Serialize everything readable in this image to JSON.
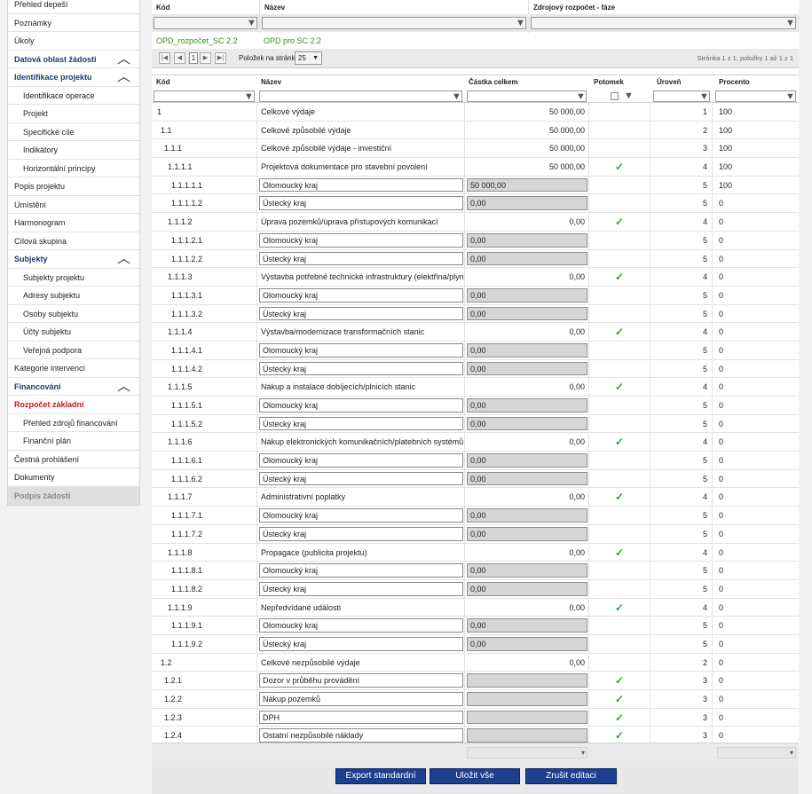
{
  "sidebar": {
    "items": [
      {
        "label": "Přehled depeší",
        "kind": "item"
      },
      {
        "label": "Poznámky",
        "kind": "item"
      },
      {
        "label": "Úkoly",
        "kind": "item"
      },
      {
        "label": "Datová oblast žádosti",
        "kind": "section",
        "chevron": "up"
      },
      {
        "label": "Identifikace projektu",
        "kind": "section",
        "chevron": "up"
      },
      {
        "label": "Identifikace operace",
        "kind": "sub"
      },
      {
        "label": "Projekt",
        "kind": "sub"
      },
      {
        "label": "Specifické cíle",
        "kind": "sub"
      },
      {
        "label": "Indikátory",
        "kind": "sub"
      },
      {
        "label": "Horizontální principy",
        "kind": "sub"
      },
      {
        "label": "Popis projektu",
        "kind": "item"
      },
      {
        "label": "Umístění",
        "kind": "item"
      },
      {
        "label": "Harmonogram",
        "kind": "item"
      },
      {
        "label": "Cílová skupina",
        "kind": "item"
      },
      {
        "label": "Subjekty",
        "kind": "section",
        "chevron": "up"
      },
      {
        "label": "Subjekty projektu",
        "kind": "sub"
      },
      {
        "label": "Adresy subjektu",
        "kind": "sub"
      },
      {
        "label": "Osoby subjektu",
        "kind": "sub"
      },
      {
        "label": "Účty subjektu",
        "kind": "sub"
      },
      {
        "label": "Veřejná podpora",
        "kind": "sub"
      },
      {
        "label": "Kategorie intervencí",
        "kind": "item"
      },
      {
        "label": "Financování",
        "kind": "section",
        "chevron": "up"
      },
      {
        "label": "Rozpočet základní",
        "kind": "active"
      },
      {
        "label": "Přehled zdrojů financování",
        "kind": "sub"
      },
      {
        "label": "Finanční plán",
        "kind": "sub"
      },
      {
        "label": "Čestná prohlášení",
        "kind": "item"
      },
      {
        "label": "Dokumenty",
        "kind": "item"
      },
      {
        "label": "Podpis žádosti",
        "kind": "disabled"
      }
    ]
  },
  "top_grid": {
    "headers": {
      "code": "Kód",
      "name": "Název",
      "source": "Zdrojový rozpočet - fáze"
    },
    "row": {
      "code": "OPD_rozpočet_SC 2.2",
      "name": "OPD pro SC 2.2",
      "source": ""
    }
  },
  "pager": {
    "first": "|◀",
    "prev": "◀",
    "page": "1",
    "next": "▶",
    "last": "▶|",
    "per_page_label": "Položek na stránku",
    "per_page_value": "25",
    "summary": "Stránka 1 z 1, položky 1 až 1 z 1"
  },
  "grid": {
    "headers": {
      "code": "Kód",
      "name": "Název",
      "amount": "Částka celkem",
      "child": "Potomek",
      "level": "Úroveň",
      "percent": "Procento"
    },
    "rows": [
      {
        "code": "1",
        "indent": 0,
        "name": "Celkové výdaje",
        "amount": "50 000,00",
        "mode": "text",
        "check": false,
        "level": "1",
        "percent": "100"
      },
      {
        "code": "1.1",
        "indent": 1,
        "name": "Celkové způsobilé výdaje",
        "amount": "50 000,00",
        "mode": "text",
        "check": false,
        "level": "2",
        "percent": "100"
      },
      {
        "code": "1.1.1",
        "indent": 2,
        "name": "Celkové způsobilé výdaje - investiční",
        "amount": "50 000,00",
        "mode": "text",
        "check": false,
        "level": "3",
        "percent": "100"
      },
      {
        "code": "1.1.1.1",
        "indent": 3,
        "name": "Projektová dokumentace pro stavební povolení",
        "amount": "50 000,00",
        "mode": "text",
        "check": true,
        "level": "4",
        "percent": "100"
      },
      {
        "code": "1.1.1.1.1",
        "indent": 4,
        "name": "Olomoucký kraj",
        "amount": "50 000,00",
        "mode": "input",
        "check": false,
        "level": "5",
        "percent": "100"
      },
      {
        "code": "1.1.1.1.2",
        "indent": 4,
        "name": "Ústecký kraj",
        "amount": "0,00",
        "mode": "input",
        "check": false,
        "level": "5",
        "percent": "0"
      },
      {
        "code": "1.1.1.2",
        "indent": 3,
        "name": "Úprava pozemků/úprava přístupových komunikací",
        "amount": "0,00",
        "mode": "text",
        "check": true,
        "level": "4",
        "percent": "0"
      },
      {
        "code": "1.1.1.2.1",
        "indent": 4,
        "name": "Olomoucký kraj",
        "amount": "0,00",
        "mode": "input",
        "check": false,
        "level": "5",
        "percent": "0"
      },
      {
        "code": "1.1.1.2.2",
        "indent": 4,
        "name": "Ústecký kraj",
        "amount": "0,00",
        "mode": "input",
        "check": false,
        "level": "5",
        "percent": "0"
      },
      {
        "code": "1.1.1.3",
        "indent": 3,
        "name": "Výstavba potřebné technické infrastruktury (elektřina/plyn)",
        "amount": "0,00",
        "mode": "text",
        "check": true,
        "level": "4",
        "percent": "0"
      },
      {
        "code": "1.1.1.3.1",
        "indent": 4,
        "name": "Olomoucký kraj",
        "amount": "0,00",
        "mode": "input",
        "check": false,
        "level": "5",
        "percent": "0"
      },
      {
        "code": "1.1.1.3.2",
        "indent": 4,
        "name": "Ústecký kraj",
        "amount": "0,00",
        "mode": "input",
        "check": false,
        "level": "5",
        "percent": "0"
      },
      {
        "code": "1.1.1.4",
        "indent": 3,
        "name": "Výstavba/modernizace transformačních stanic",
        "amount": "0,00",
        "mode": "text",
        "check": true,
        "level": "4",
        "percent": "0"
      },
      {
        "code": "1.1.1.4.1",
        "indent": 4,
        "name": "Olomoucký kraj",
        "amount": "0,00",
        "mode": "input",
        "check": false,
        "level": "5",
        "percent": "0"
      },
      {
        "code": "1.1.1.4.2",
        "indent": 4,
        "name": "Ústecký kraj",
        "amount": "0,00",
        "mode": "input",
        "check": false,
        "level": "5",
        "percent": "0"
      },
      {
        "code": "1.1.1.5",
        "indent": 3,
        "name": "Nákup a instalace dobíjecích/plnicích stanic",
        "amount": "0,00",
        "mode": "text",
        "check": true,
        "level": "4",
        "percent": "0"
      },
      {
        "code": "1.1.1.5.1",
        "indent": 4,
        "name": "Olomoucký kraj",
        "amount": "0,00",
        "mode": "input",
        "check": false,
        "level": "5",
        "percent": "0"
      },
      {
        "code": "1.1.1.5.2",
        "indent": 4,
        "name": "Ústecký kraj",
        "amount": "0,00",
        "mode": "input",
        "check": false,
        "level": "5",
        "percent": "0"
      },
      {
        "code": "1.1.1.6",
        "indent": 3,
        "name": "Nákup elektronických komunikačních/platebních systémů",
        "amount": "0,00",
        "mode": "text",
        "check": true,
        "level": "4",
        "percent": "0"
      },
      {
        "code": "1.1.1.6.1",
        "indent": 4,
        "name": "Olomoucký kraj",
        "amount": "0,00",
        "mode": "input",
        "check": false,
        "level": "5",
        "percent": "0"
      },
      {
        "code": "1.1.1.6.2",
        "indent": 4,
        "name": "Ústecký kraj",
        "amount": "0,00",
        "mode": "input",
        "check": false,
        "level": "5",
        "percent": "0"
      },
      {
        "code": "1.1.1.7",
        "indent": 3,
        "name": "Administrativní poplatky",
        "amount": "0,00",
        "mode": "text",
        "check": true,
        "level": "4",
        "percent": "0"
      },
      {
        "code": "1.1.1.7.1",
        "indent": 4,
        "name": "Olomoucký kraj",
        "amount": "0,00",
        "mode": "input",
        "check": false,
        "level": "5",
        "percent": "0"
      },
      {
        "code": "1.1.1.7.2",
        "indent": 4,
        "name": "Ústecký kraj",
        "amount": "0,00",
        "mode": "input",
        "check": false,
        "level": "5",
        "percent": "0"
      },
      {
        "code": "1.1.1.8",
        "indent": 3,
        "name": "Propagace (publicita projektu)",
        "amount": "0,00",
        "mode": "text",
        "check": true,
        "level": "4",
        "percent": "0"
      },
      {
        "code": "1.1.1.8.1",
        "indent": 4,
        "name": "Olomoucký kraj",
        "amount": "0,00",
        "mode": "input",
        "check": false,
        "level": "5",
        "percent": "0"
      },
      {
        "code": "1.1.1.8.2",
        "indent": 4,
        "name": "Ústecký kraj",
        "amount": "0,00",
        "mode": "input",
        "check": false,
        "level": "5",
        "percent": "0"
      },
      {
        "code": "1.1.1.9",
        "indent": 3,
        "name": "Nepředvídané události",
        "amount": "0,00",
        "mode": "text",
        "check": true,
        "level": "4",
        "percent": "0"
      },
      {
        "code": "1.1.1.9.1",
        "indent": 4,
        "name": "Olomoucký kraj",
        "amount": "0,00",
        "mode": "input",
        "check": false,
        "level": "5",
        "percent": "0"
      },
      {
        "code": "1.1.1.9.2",
        "indent": 4,
        "name": "Ústecký kraj",
        "amount": "0,00",
        "mode": "input",
        "check": false,
        "level": "5",
        "percent": "0"
      },
      {
        "code": "1.2",
        "indent": 1,
        "name": "Celkové nezpůsobilé výdaje",
        "amount": "0,00",
        "mode": "text",
        "check": false,
        "level": "2",
        "percent": "0"
      },
      {
        "code": "1.2.1",
        "indent": 2,
        "name": "Dozor v průběhu provádění",
        "amount": "",
        "mode": "input",
        "check": true,
        "level": "3",
        "percent": "0"
      },
      {
        "code": "1.2.2",
        "indent": 2,
        "name": "Nákup pozemků",
        "amount": "",
        "mode": "input",
        "check": true,
        "level": "3",
        "percent": "0"
      },
      {
        "code": "1.2.3",
        "indent": 2,
        "name": "DPH",
        "amount": "",
        "mode": "input",
        "check": true,
        "level": "3",
        "percent": "0"
      },
      {
        "code": "1.2.4",
        "indent": 2,
        "name": "Ostatní nezpůsobilé náklady",
        "amount": "",
        "mode": "input",
        "check": true,
        "level": "3",
        "percent": "0"
      }
    ]
  },
  "footer": {
    "amount_dropdown": "▾",
    "percent_dropdown": "▾"
  },
  "buttons": {
    "export": "Export standardní",
    "save": "Uložit vše",
    "cancel": "Zrušit editaci"
  },
  "icons": {
    "filter": "filter-icon",
    "check": "checkmark-icon",
    "chevron": "chevron-up-icon"
  },
  "colors": {
    "section": "#1f3a6f",
    "active": "#c8141e",
    "button": "#1c3f8e",
    "check": "#2ea52e",
    "green_text": "#3c8c1c"
  }
}
